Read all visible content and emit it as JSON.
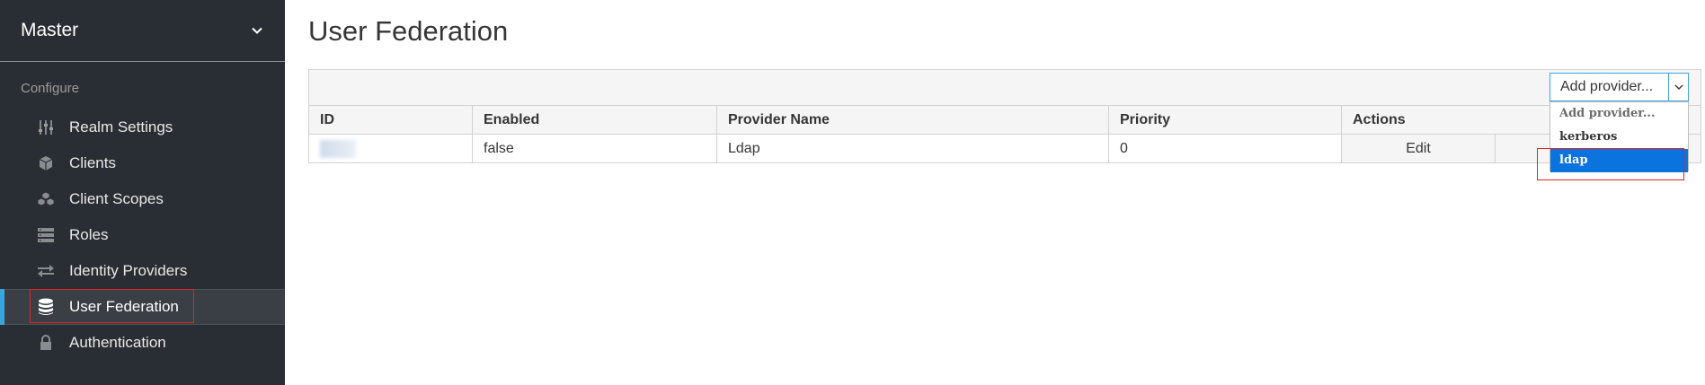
{
  "sidebar": {
    "realm_name": "Master",
    "section_label": "Configure",
    "items": [
      {
        "label": "Realm Settings",
        "icon": "sliders-icon"
      },
      {
        "label": "Clients",
        "icon": "cube-icon"
      },
      {
        "label": "Client Scopes",
        "icon": "cubes-icon"
      },
      {
        "label": "Roles",
        "icon": "list-icon"
      },
      {
        "label": "Identity Providers",
        "icon": "exchange-icon"
      },
      {
        "label": "User Federation",
        "icon": "database-icon",
        "active": true
      },
      {
        "label": "Authentication",
        "icon": "lock-icon"
      }
    ]
  },
  "main": {
    "title": "User Federation",
    "provider_select": {
      "value": "Add provider...",
      "options": [
        "Add provider...",
        "kerberos",
        "ldap"
      ],
      "selected": "ldap"
    },
    "table": {
      "headers": [
        "ID",
        "Enabled",
        "Provider Name",
        "Priority",
        "Actions"
      ],
      "rows": [
        {
          "id": "",
          "enabled": "false",
          "provider_name": "Ldap",
          "priority": "0",
          "action_edit": "Edit"
        }
      ]
    }
  },
  "colors": {
    "sidebar_bg": "#292e34",
    "active_accent": "#39a5dc",
    "highlight_option": "#0a73de",
    "annotation_red": "#e0232a"
  }
}
